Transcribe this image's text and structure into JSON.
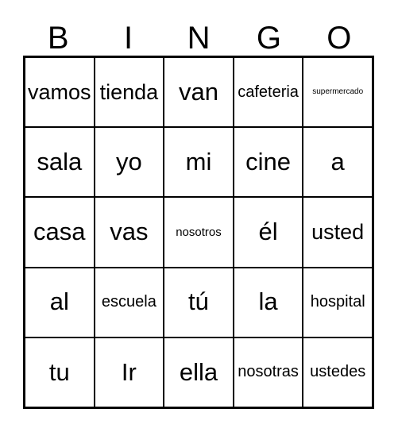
{
  "card": {
    "title": "BINGO",
    "headers": [
      "B",
      "I",
      "N",
      "G",
      "O"
    ],
    "colors": {
      "border": "#000000",
      "background": "#ffffff",
      "text": "#000000"
    },
    "rows": [
      {
        "cells": [
          {
            "text": "vamos",
            "size": "lg"
          },
          {
            "text": "tienda",
            "size": "lg"
          },
          {
            "text": "van",
            "size": "xl"
          },
          {
            "text": "cafeteria",
            "size": "md"
          },
          {
            "text": "supermercado",
            "size": "xs"
          }
        ]
      },
      {
        "cells": [
          {
            "text": "sala",
            "size": "xl"
          },
          {
            "text": "yo",
            "size": "xl"
          },
          {
            "text": "mi",
            "size": "xl"
          },
          {
            "text": "cine",
            "size": "xl"
          },
          {
            "text": "a",
            "size": "xl"
          }
        ]
      },
      {
        "cells": [
          {
            "text": "casa",
            "size": "xl"
          },
          {
            "text": "vas",
            "size": "xl"
          },
          {
            "text": "nosotros",
            "size": "sm"
          },
          {
            "text": "él",
            "size": "xl"
          },
          {
            "text": "usted",
            "size": "lg"
          }
        ]
      },
      {
        "cells": [
          {
            "text": "al",
            "size": "xl"
          },
          {
            "text": "escuela",
            "size": "md"
          },
          {
            "text": "tú",
            "size": "xl"
          },
          {
            "text": "la",
            "size": "xl"
          },
          {
            "text": "hospital",
            "size": "md"
          }
        ]
      },
      {
        "cells": [
          {
            "text": "tu",
            "size": "xl"
          },
          {
            "text": "Ir",
            "size": "xl"
          },
          {
            "text": "ella",
            "size": "xl"
          },
          {
            "text": "nosotras",
            "size": "md"
          },
          {
            "text": "ustedes",
            "size": "md"
          }
        ]
      }
    ]
  }
}
